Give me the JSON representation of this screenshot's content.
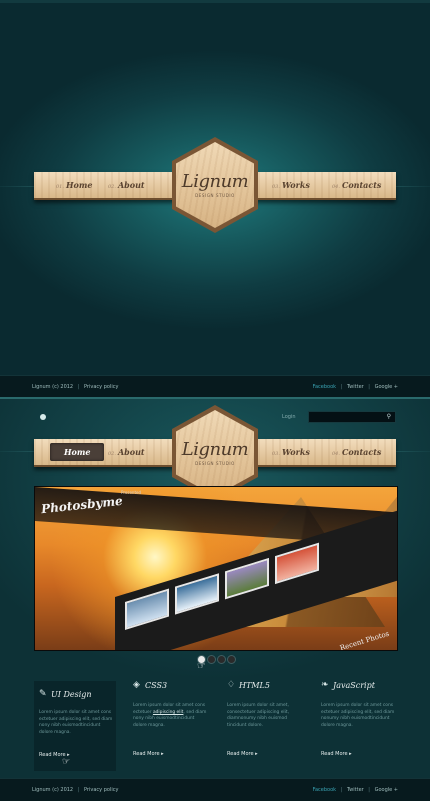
{
  "splash": {
    "nav": [
      {
        "num": "01.",
        "label": "Home"
      },
      {
        "num": "02.",
        "label": "About"
      },
      {
        "num": "03.",
        "label": "Works"
      },
      {
        "num": "04.",
        "label": "Contacts"
      }
    ],
    "logo": {
      "name": "Lignum",
      "tagline": "DESIGN STUDIO"
    },
    "footer": {
      "copyright": "Lignum (c) 2012",
      "privacy": "Privacy policy",
      "social": [
        "Facebook",
        "Twitter",
        "Google +"
      ]
    }
  },
  "site": {
    "topbar": {
      "login": "Login",
      "search_placeholder": ""
    },
    "nav": [
      {
        "num": "01.",
        "label": "Home"
      },
      {
        "num": "02.",
        "label": "About"
      },
      {
        "num": "03.",
        "label": "Works"
      },
      {
        "num": "04.",
        "label": "Contacts"
      }
    ],
    "logo": {
      "name": "Lignum",
      "tagline": "DESIGN STUDIO"
    },
    "slider": {
      "title": "Photosbyme",
      "subtitle": "Presented",
      "caption": "Recent Photos",
      "active_dot": 1,
      "dot_count": 4
    },
    "features": [
      {
        "icon": "edit-icon",
        "title": "UI Design",
        "text_pre": "Lorem ipsum dolor sit amet cons ectetuer adipiscing elit, sed diam nony nibh euismodtincidunt dolore magna.",
        "link_word": "",
        "read_more": "Read More"
      },
      {
        "icon": "globe-icon",
        "title": "CSS3",
        "text_pre": "Lorem ipsum dolor sit amet cons ectetuer ",
        "link_word": "adipiscing elit",
        "text_post": ", sed diam nony nibh euismodtincidunt dolore magna.",
        "read_more": "Read More"
      },
      {
        "icon": "html5-icon",
        "title": "HTML5",
        "text_pre": "Lorem ipsum dolor sit amet, consectetuer adipiscing elit, diamnonumy nibh euismod tincidunt dolore.",
        "link_word": "",
        "read_more": "Read More"
      },
      {
        "icon": "leaf-icon",
        "title": "JavaScript",
        "text_pre": "Lorem ipsum dolor sit amet cons ectetuer adipiscing elit, sed diam nonumy nibh euismodtincidunt dolore magna.",
        "link_word": "",
        "read_more": "Read More"
      }
    ],
    "footer": {
      "copyright": "Lignum (c) 2012",
      "privacy": "Privacy policy",
      "social": [
        "Facebook",
        "Twitter",
        "Google +"
      ]
    }
  }
}
